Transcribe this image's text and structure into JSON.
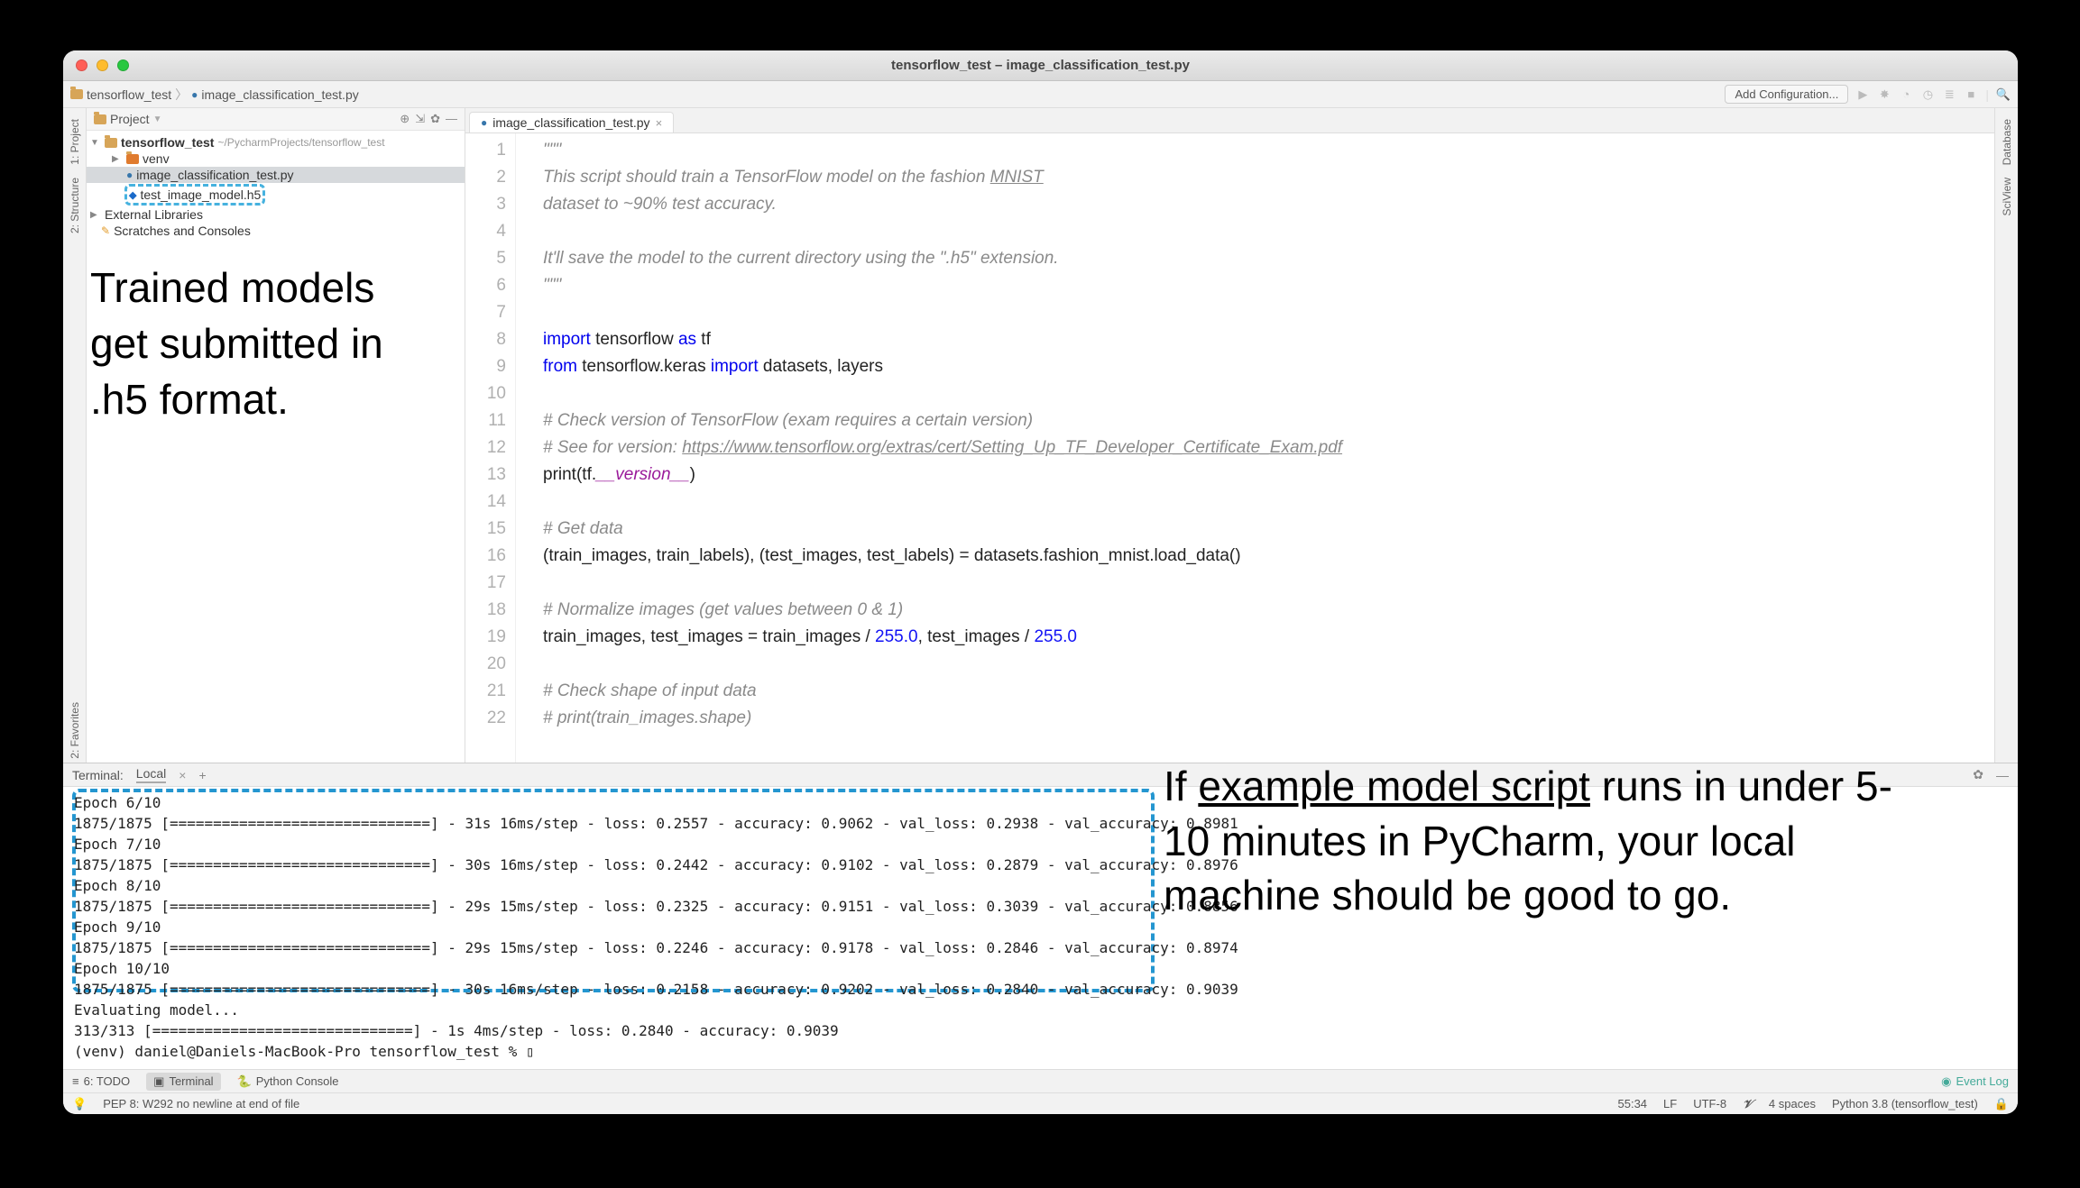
{
  "window": {
    "title": "tensorflow_test – image_classification_test.py"
  },
  "breadcrumbs": {
    "project": "tensorflow_test",
    "file": "image_classification_test.py"
  },
  "toolbar": {
    "addConfig": "Add Configuration..."
  },
  "sidebarRails": {
    "left": [
      "1: Project",
      "2: Structure",
      "2: Favorites"
    ],
    "right": [
      "Database",
      "SciView"
    ]
  },
  "projectPanel": {
    "title": "Project",
    "root": "tensorflow_test",
    "rootPath": "~/PycharmProjects/tensorflow_test",
    "items": [
      {
        "name": "venv",
        "kind": "folder"
      },
      {
        "name": "image_classification_test.py",
        "kind": "py",
        "selected": true
      },
      {
        "name": "test_image_model.h5",
        "kind": "h5",
        "highlighted": true
      }
    ],
    "extraTop": [
      "External Libraries",
      "Scratches and Consoles"
    ]
  },
  "editor": {
    "tabLabel": "image_classification_test.py",
    "lines": [
      {
        "n": 1,
        "html": "<span class='c-str'>\"\"\"</span>"
      },
      {
        "n": 2,
        "html": "<span class='c-str'>This script should train a TensorFlow model on the fashion <u>MNIST</u></span>"
      },
      {
        "n": 3,
        "html": "<span class='c-str'>dataset to ~90% test accuracy.</span>"
      },
      {
        "n": 4,
        "html": ""
      },
      {
        "n": 5,
        "html": "<span class='c-str'>It'll save the model to the current directory using the \".h5\" extension.</span>"
      },
      {
        "n": 6,
        "html": "<span class='c-str'>\"\"\"</span>"
      },
      {
        "n": 7,
        "html": ""
      },
      {
        "n": 8,
        "html": "<span class='c-kw'>import</span> tensorflow <span class='c-kw'>as</span> tf"
      },
      {
        "n": 9,
        "html": "<span class='c-kw'>from</span> tensorflow.keras <span class='c-kw'>import</span> datasets, layers"
      },
      {
        "n": 10,
        "html": ""
      },
      {
        "n": 11,
        "html": "<span class='c-cmt'># Check version of TensorFlow (exam requires a certain version)</span>"
      },
      {
        "n": 12,
        "html": "<span class='c-cmt'># See for version: <span class='c-link'>https://www.tensorflow.org/extras/cert/Setting_Up_TF_Developer_Certificate_Exam.pdf</span></span>"
      },
      {
        "n": 13,
        "html": "print(tf.<span class='c-dunder'>__version__</span>)"
      },
      {
        "n": 14,
        "html": ""
      },
      {
        "n": 15,
        "html": "<span class='c-cmt'># Get data</span>"
      },
      {
        "n": 16,
        "html": "(train_images, train_labels), (test_images, test_labels) = datasets.fashion_mnist.load_data()"
      },
      {
        "n": 17,
        "html": ""
      },
      {
        "n": 18,
        "html": "<span class='c-cmt'># Normalize images (get values between 0 &amp; 1)</span>"
      },
      {
        "n": 19,
        "html": "train_images, test_images = train_images / <span class='c-num'>255.0</span>, test_images / <span class='c-num'>255.0</span>"
      },
      {
        "n": 20,
        "html": ""
      },
      {
        "n": 21,
        "html": "<span class='c-cmt'># Check shape of input data</span>"
      },
      {
        "n": 22,
        "html": "<span class='c-cmt'># print(train_images.shape)</span>"
      }
    ]
  },
  "terminalHeader": {
    "label": "Terminal:",
    "tab": "Local",
    "plus": "+"
  },
  "terminalOutput": [
    "Epoch 6/10",
    "1875/1875 [==============================] - 31s 16ms/step - loss: 0.2557 - accuracy: 0.9062 - val_loss: 0.2938 - val_accuracy: 0.8981",
    "Epoch 7/10",
    "1875/1875 [==============================] - 30s 16ms/step - loss: 0.2442 - accuracy: 0.9102 - val_loss: 0.2879 - val_accuracy: 0.8976",
    "Epoch 8/10",
    "1875/1875 [==============================] - 29s 15ms/step - loss: 0.2325 - accuracy: 0.9151 - val_loss: 0.3039 - val_accuracy: 0.8856",
    "Epoch 9/10",
    "1875/1875 [==============================] - 29s 15ms/step - loss: 0.2246 - accuracy: 0.9178 - val_loss: 0.2846 - val_accuracy: 0.8974",
    "Epoch 10/10",
    "1875/1875 [==============================] - 30s 16ms/step - loss: 0.2158 - accuracy: 0.9202 - val_loss: 0.2840 - val_accuracy: 0.9039",
    "Evaluating model...",
    "313/313 [==============================] - 1s 4ms/step - loss: 0.2840 - accuracy: 0.9039",
    "(venv) daniel@Daniels-MacBook-Pro tensorflow_test % ▯"
  ],
  "bottomTabs": {
    "todo": "6: TODO",
    "terminal": "Terminal",
    "console": "Python Console",
    "eventLog": "Event Log"
  },
  "statusBar": {
    "left": "PEP 8: W292 no newline at end of file",
    "pos": "55:34",
    "eol": "LF",
    "enc": "UTF-8",
    "spaces": "4 spaces",
    "interp": "Python 3.8 (tensorflow_test)"
  },
  "annotations": {
    "a1": "Trained models get submitted in .h5 format.",
    "a2_pre": "If ",
    "a2_link": "example model script",
    "a2_post": " runs in under 5-10 minutes in PyCharm, your local machine should be good to go."
  }
}
